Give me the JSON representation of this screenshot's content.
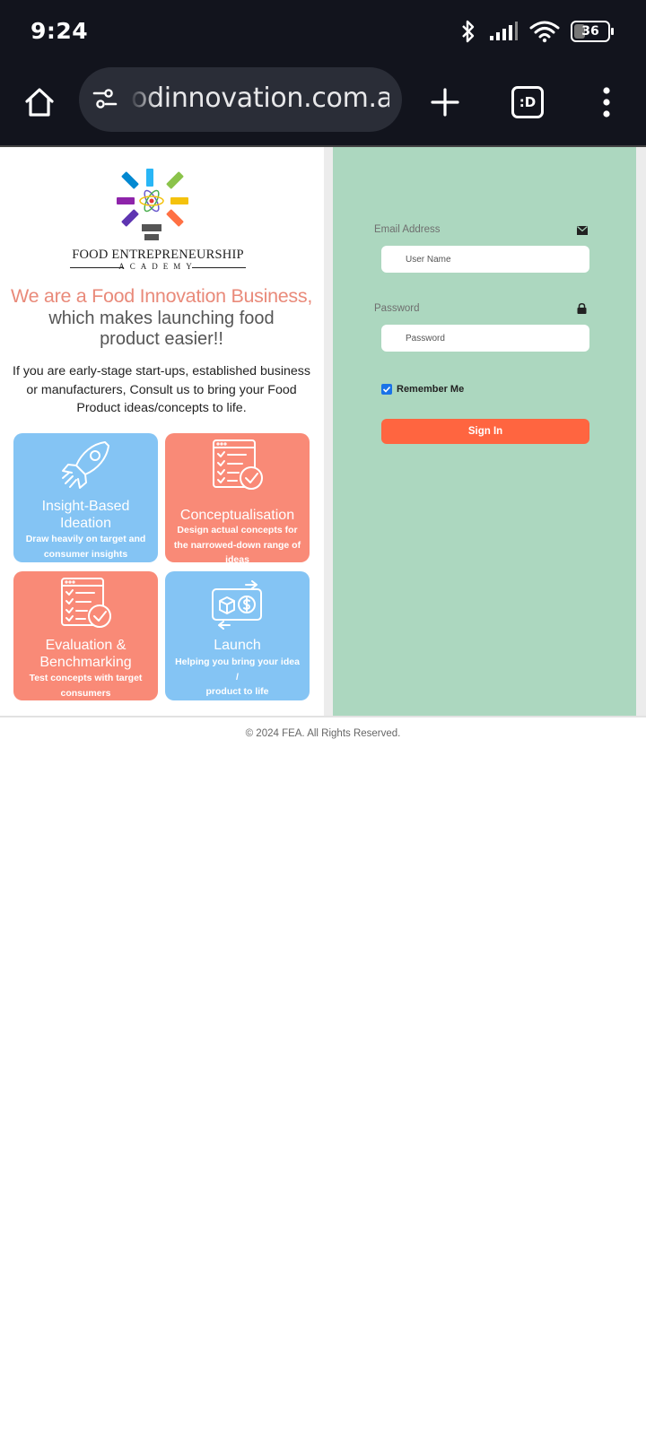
{
  "status_bar": {
    "time": "9:24",
    "battery": "36",
    "icons": [
      "bluetooth-icon",
      "signal-icon",
      "wifi-icon",
      "battery-icon"
    ]
  },
  "browser": {
    "url": "odinnovation.com.au",
    "tabs_label": ":D",
    "icons": [
      "home-icon",
      "tune-icon",
      "plus-icon",
      "tabs-icon",
      "more-vert-icon"
    ]
  },
  "brand": {
    "name": "FOOD ENTREPRENEURSHIP",
    "sub": "ACADEMY",
    "logo_colors": [
      "#f4c20d",
      "#8bc34a",
      "#ff7043",
      "#e53935",
      "#5e35b1",
      "#8e24aa",
      "#29b6f6",
      "#00acc1"
    ]
  },
  "hero": {
    "headline": "We are a Food Innovation Business,",
    "subheadline": "which makes launching food product easier!!",
    "body": "If you are early-stage start-ups, established business or manufacturers, Consult us to bring your Food Product ideas/concepts to life."
  },
  "cards": [
    {
      "title": "Insight-Based Ideation",
      "desc": "Draw heavily on target and consumer insights",
      "icon": "rocket-icon",
      "color": "#84c4f4"
    },
    {
      "title": "Conceptualisation",
      "desc": "Design actual concepts for the narrowed-down range of ideas",
      "icon": "checklist-icon",
      "color": "#f98a77"
    },
    {
      "title": "Evaluation & Benchmarking",
      "desc": "Test concepts with target consumers",
      "icon": "checklist-icon",
      "color": "#f98a77"
    },
    {
      "title": "Launch",
      "desc_lines": [
        "Helping you bring your idea",
        "/",
        "product to life"
      ],
      "icon": "product-money-icon",
      "color": "#84c4f4"
    }
  ],
  "login": {
    "email_label": "Email Address",
    "email_placeholder": "User Name",
    "password_label": "Password",
    "password_placeholder": "Password",
    "remember_label": "Remember Me",
    "remember_checked": true,
    "signin_label": "Sign In",
    "panel_color": "#acd7bf",
    "button_color": "#ff6540"
  },
  "footer": {
    "copyright": "© 2024 FEA. All Rights Reserved."
  }
}
